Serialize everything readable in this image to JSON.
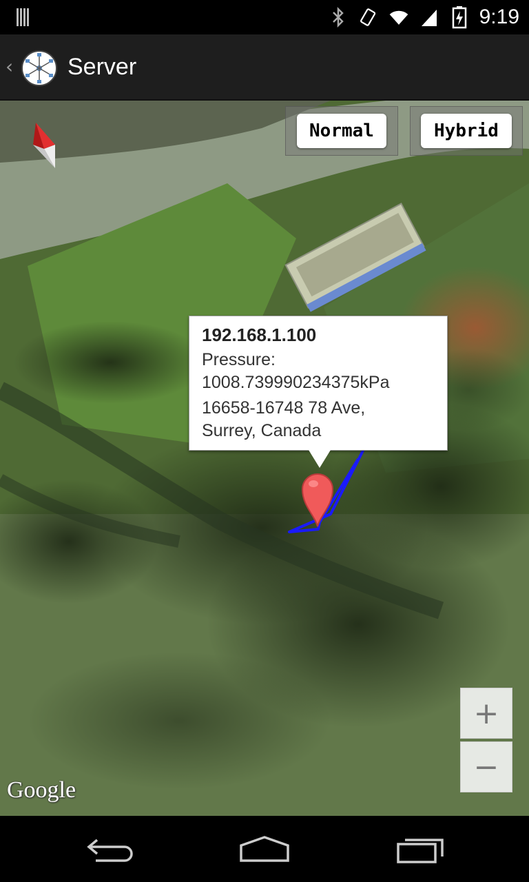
{
  "status_bar": {
    "time": "9:19",
    "icons": [
      "notification-bars-icon",
      "bluetooth-icon",
      "vibrate-icon",
      "wifi-icon",
      "signal-icon",
      "battery-charging-icon"
    ]
  },
  "action_bar": {
    "title": "Server",
    "logo_icon": "network-hub-icon"
  },
  "map": {
    "map_type_buttons": [
      "Normal",
      "Hybrid"
    ],
    "info_window": {
      "title": "192.168.1.100",
      "pressure_label": "Pressure:",
      "pressure_value": "1008.739990234375kPa",
      "address_line1": "16658-16748 78 Ave,",
      "address_line2": "Surrey, Canada"
    },
    "zoom_in_label": "+",
    "zoom_out_label": "−",
    "attribution": "Google",
    "route_color": "#1a1aff",
    "marker_color": "#f05a5a"
  },
  "nav_bar": {
    "icons": [
      "back-icon",
      "home-icon",
      "recent-apps-icon"
    ]
  }
}
